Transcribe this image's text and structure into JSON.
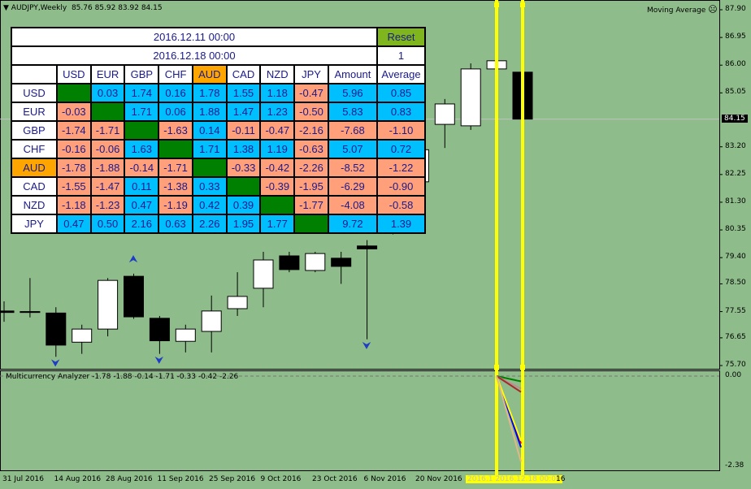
{
  "header": {
    "symbol": "AUDJPY,Weekly",
    "ohlc": "85.76 85.92 83.92 84.15"
  },
  "indicator_label": "Moving Average",
  "price_axis": [
    "87.90",
    "86.95",
    "86.00",
    "85.05",
    "83.20",
    "82.25",
    "81.30",
    "80.35",
    "79.40",
    "78.50",
    "77.55",
    "76.65",
    "75.70"
  ],
  "current_price": "84.15",
  "sub_window": {
    "title": "Multicurrency Analyzer -1.78 -1.88 -0.14 -1.71 -0.33 -0.42 -2.26",
    "axis_top": "0.00",
    "axis_bottom": "-2.38",
    "lines": [
      {
        "v": -1.78,
        "color": "#ff0000"
      },
      {
        "v": -1.88,
        "color": "#0000ff"
      },
      {
        "v": -0.14,
        "color": "#008000"
      },
      {
        "v": -1.71,
        "color": "#ffff00"
      },
      {
        "v": -0.33,
        "color": "#bc8f8f"
      },
      {
        "v": -0.42,
        "color": "#a52a2a"
      },
      {
        "v": -2.26,
        "color": "#deb887"
      }
    ]
  },
  "x_axis": [
    "31 Jul 2016",
    "14 Aug 2016",
    "28 Aug 2016",
    "11 Sep 2016",
    "25 Sep 2016",
    "9 Oct 2016",
    "23 Oct 2016",
    "6 Nov 2016",
    "20 Nov 2016"
  ],
  "x_axis_highlight": "2016.1 2016.12.18 00:00",
  "x_axis_tail": "16",
  "table": {
    "date_from": "2016.12.11 00:00",
    "date_to": "2016.12.18 00:00",
    "reset_label": "Reset",
    "count": "1",
    "columns": [
      "USD",
      "EUR",
      "GBP",
      "CHF",
      "AUD",
      "CAD",
      "NZD",
      "JPY",
      "Amount",
      "Average"
    ],
    "rows": [
      {
        "name": "USD",
        "cells": [
          "",
          "0.03",
          "1.74",
          "0.16",
          "1.78",
          "1.55",
          "1.18",
          "-0.47",
          "5.96",
          "0.85"
        ]
      },
      {
        "name": "EUR",
        "cells": [
          "-0.03",
          "",
          "1.71",
          "0.06",
          "1.88",
          "1.47",
          "1.23",
          "-0.50",
          "5.83",
          "0.83"
        ]
      },
      {
        "name": "GBP",
        "cells": [
          "-1.74",
          "-1.71",
          "",
          "-1.63",
          "0.14",
          "-0.11",
          "-0.47",
          "-2.16",
          "-7.68",
          "-1.10"
        ]
      },
      {
        "name": "CHF",
        "cells": [
          "-0.16",
          "-0.06",
          "1.63",
          "",
          "1.71",
          "1.38",
          "1.19",
          "-0.63",
          "5.07",
          "0.72"
        ]
      },
      {
        "name": "AUD",
        "cells": [
          "-1.78",
          "-1.88",
          "-0.14",
          "-1.71",
          "",
          "-0.33",
          "-0.42",
          "-2.26",
          "-8.52",
          "-1.22"
        ]
      },
      {
        "name": "CAD",
        "cells": [
          "-1.55",
          "-1.47",
          "0.11",
          "-1.38",
          "0.33",
          "",
          "-0.39",
          "-1.95",
          "-6.29",
          "-0.90"
        ]
      },
      {
        "name": "NZD",
        "cells": [
          "-1.18",
          "-1.23",
          "0.47",
          "-1.19",
          "0.42",
          "0.39",
          "",
          "-1.77",
          "-4.08",
          "-0.58"
        ]
      },
      {
        "name": "JPY",
        "cells": [
          "0.47",
          "0.50",
          "2.16",
          "0.63",
          "2.26",
          "1.95",
          "1.77",
          "",
          "9.72",
          "1.39"
        ]
      }
    ]
  },
  "colors": {
    "positive": "#00bfff",
    "negative": "#ffa07a",
    "diagonal": "#008000",
    "selected": "#ffa500",
    "bg": "#8fbc8b",
    "vline": "#ffff00"
  },
  "chart_data": {
    "type": "candlestick",
    "ylim": [
      75.7,
      87.9
    ],
    "candles": [
      [
        77.57,
        77.9,
        77.2,
        77.52
      ],
      [
        77.55,
        78.7,
        77.35,
        77.52
      ],
      [
        77.5,
        77.7,
        76.0,
        76.4
      ],
      [
        76.5,
        77.1,
        76.1,
        76.95
      ],
      [
        76.95,
        78.7,
        76.7,
        78.62
      ],
      [
        78.76,
        78.85,
        77.3,
        77.37
      ],
      [
        77.32,
        77.4,
        76.1,
        76.55
      ],
      [
        76.53,
        77.1,
        76.15,
        76.95
      ],
      [
        76.87,
        78.1,
        76.15,
        77.57
      ],
      [
        77.65,
        78.9,
        77.4,
        78.07
      ],
      [
        78.35,
        79.6,
        77.7,
        79.32
      ],
      [
        79.46,
        79.6,
        78.9,
        78.99
      ],
      [
        78.96,
        79.6,
        78.9,
        79.54
      ],
      [
        79.38,
        79.6,
        78.5,
        79.1
      ],
      [
        79.8,
        80.0,
        76.6,
        79.7
      ],
      [
        80.5,
        81.6,
        80.2,
        81.4
      ],
      [
        82.0,
        83.3,
        81.8,
        83.1
      ],
      [
        83.97,
        84.84,
        83.16,
        84.67
      ],
      [
        83.92,
        86.06,
        83.78,
        85.87
      ],
      [
        85.87,
        86.15,
        85.87,
        86.15
      ],
      [
        85.76,
        85.92,
        83.92,
        84.15
      ]
    ],
    "arrows_up": [
      5
    ],
    "arrows_down": [
      2,
      6,
      14
    ]
  }
}
